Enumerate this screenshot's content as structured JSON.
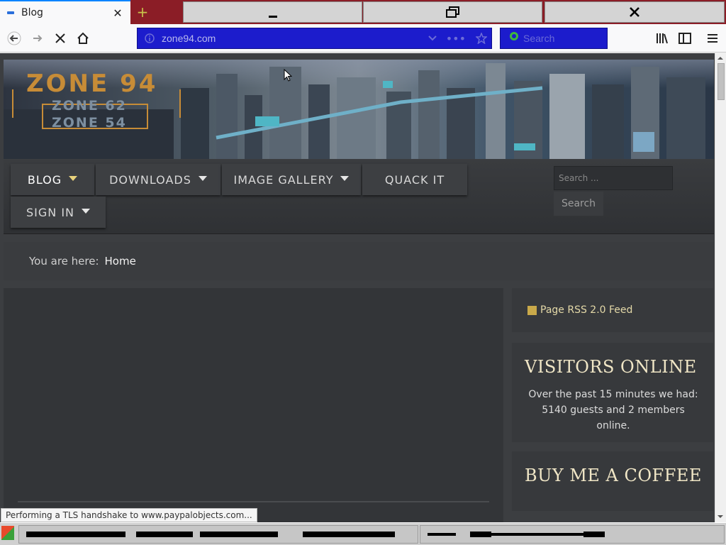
{
  "browser": {
    "tab": {
      "title": "Blog"
    },
    "url": "zone94.com",
    "search_placeholder": "Search",
    "status_text": "Performing a TLS handshake to www.paypalobjects.com..."
  },
  "site": {
    "logo": {
      "main": "ZONE 94",
      "sub1": "ZONE 62",
      "sub2": "ZONE 54"
    },
    "menu": [
      {
        "label": "BLOG",
        "dropdown": true
      },
      {
        "label": "DOWNLOADS",
        "dropdown": true
      },
      {
        "label": "IMAGE GALLERY",
        "dropdown": true
      },
      {
        "label": "QUACK IT",
        "dropdown": false
      },
      {
        "label": "SIGN IN",
        "dropdown": true
      }
    ],
    "search": {
      "placeholder": "Search ...",
      "button": "Search"
    },
    "breadcrumb": {
      "label": "You are here:",
      "current": "Home"
    },
    "sidebar": {
      "rss": "Page RSS 2.0 Feed",
      "visitors_title": "VISITORS ONLINE",
      "visitors_text": "Over the past 15 minutes we had: 5140 guests and 2 members online.",
      "coffee_title": "BUY ME A COFFEE"
    }
  },
  "colors": {
    "accent": "#c78c37",
    "tab_strip": "#8b1d26",
    "urlbar": "#1c1ccc",
    "page_bg": "#3c3e41"
  }
}
